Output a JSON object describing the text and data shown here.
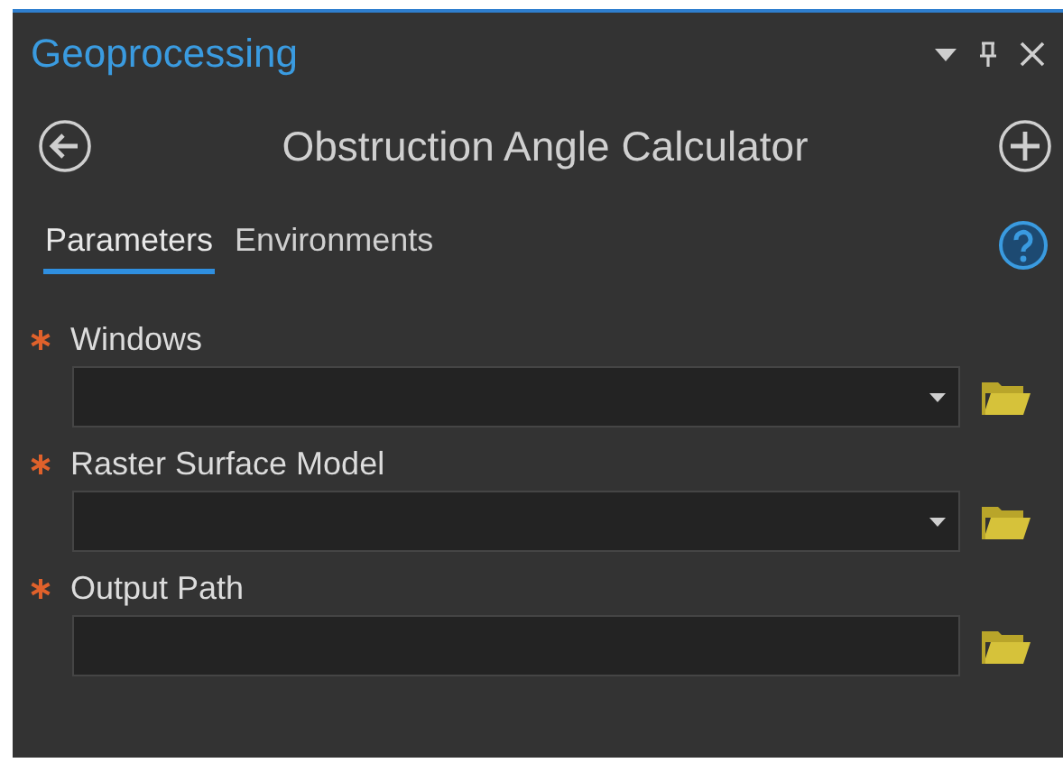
{
  "pane": {
    "title": "Geoprocessing"
  },
  "tool": {
    "title": "Obstruction Angle Calculator"
  },
  "tabs": [
    {
      "label": "Parameters",
      "selected": true
    },
    {
      "label": "Environments",
      "selected": false
    }
  ],
  "parameters": [
    {
      "label": "Windows",
      "required": true,
      "kind": "dropdown"
    },
    {
      "label": "Raster Surface Model",
      "required": true,
      "kind": "dropdown"
    },
    {
      "label": "Output Path",
      "required": true,
      "kind": "text"
    }
  ]
}
